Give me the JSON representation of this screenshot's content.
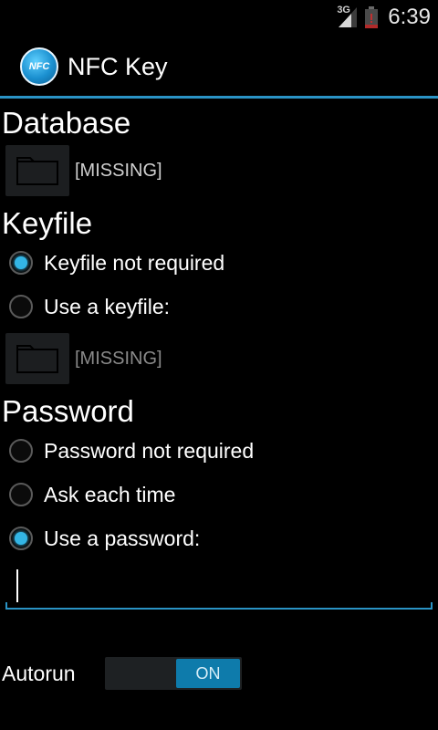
{
  "status_bar": {
    "network_type": "3G",
    "time": "6:39"
  },
  "app": {
    "title": "NFC Key",
    "icon_text": "NFC",
    "accent_color": "#33b5e5"
  },
  "database": {
    "section_title": "Database",
    "path": "[MISSING]"
  },
  "keyfile": {
    "section_title": "Keyfile",
    "options": [
      {
        "label": "Keyfile not required",
        "checked": true
      },
      {
        "label": "Use a keyfile:",
        "checked": false
      }
    ],
    "path": "[MISSING]"
  },
  "password": {
    "section_title": "Password",
    "options": [
      {
        "label": "Password not required",
        "checked": false
      },
      {
        "label": "Ask each time",
        "checked": false
      },
      {
        "label": "Use a password:",
        "checked": true
      }
    ],
    "input_value": ""
  },
  "autorun": {
    "label": "Autorun",
    "state_label": "ON",
    "on": true
  }
}
